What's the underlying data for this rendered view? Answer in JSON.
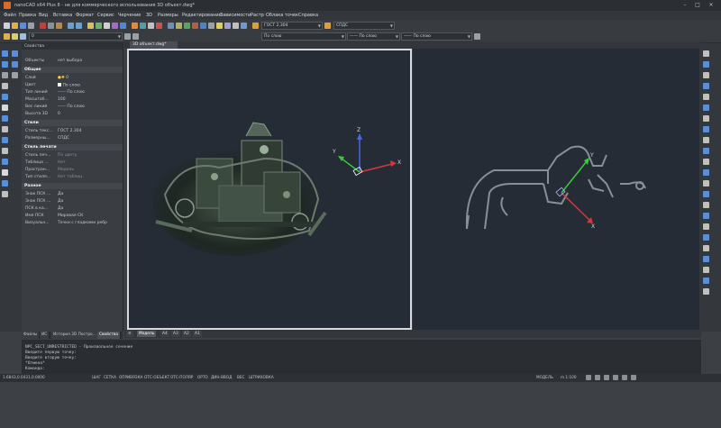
{
  "window": {
    "title": "nanoCAD x64 Plus 8 - не для коммерческого использования 3D объект.dwg*",
    "controls": [
      "–",
      "□",
      "×"
    ]
  },
  "menu": [
    "Файл",
    "Правка",
    "Вид",
    "Вставка",
    "Формат",
    "Сервис",
    "Черчение",
    "3D",
    "Размеры",
    "Редактирование",
    "Зависимости",
    "Растр",
    "Облака точек",
    "Справка"
  ],
  "toolbar": {
    "textstyle": "ГОСТ 2.304",
    "dimstyle": "СПДС",
    "layer": "0",
    "linetype": "По слою",
    "lineweight": "По слою",
    "color": "По слою"
  },
  "properties": {
    "header": "Свойства",
    "object_label": "Объекты",
    "object_value": "нет выбора",
    "categories": [
      {
        "name": "Общие",
        "rows": [
          {
            "k": "Слой",
            "v": "0"
          },
          {
            "k": "Цвет",
            "v": "По слою"
          },
          {
            "k": "Тип линий",
            "v": "—— По слою"
          },
          {
            "k": "Масштаб...",
            "v": "100"
          },
          {
            "k": "Вес линий",
            "v": "—— По слою"
          },
          {
            "k": "Высота 3D",
            "v": "0"
          }
        ]
      },
      {
        "name": "Стили",
        "rows": [
          {
            "k": "Стиль текс...",
            "v": "ГОСТ 2.304"
          },
          {
            "k": "Размерны...",
            "v": "СПДС"
          }
        ]
      },
      {
        "name": "Стиль печати",
        "rows": [
          {
            "k": "Стиль печ...",
            "v": "По цвету"
          },
          {
            "k": "Таблица ...",
            "v": "Нет"
          },
          {
            "k": "Простран...",
            "v": "Модель"
          },
          {
            "k": "Тип стиля...",
            "v": "Нет таблиц"
          }
        ]
      },
      {
        "name": "Разное",
        "rows": [
          {
            "k": "Знак ПСК ...",
            "v": "Да"
          },
          {
            "k": "Знак ПСК ...",
            "v": "Да"
          },
          {
            "k": "ПСК в ка...",
            "v": "Да"
          },
          {
            "k": "Имя ПСК",
            "v": "Мировая СК"
          },
          {
            "k": "Визуальн...",
            "v": "Точки с гладкими ребр"
          }
        ]
      }
    ],
    "tabs": [
      "Файлы",
      "ИС",
      "История 3D Постро...",
      "Свойства"
    ]
  },
  "document": {
    "tab": "3D объект.dwg*"
  },
  "viewport": {
    "axis_x": "X",
    "axis_y": "Y",
    "axis_z": "Z"
  },
  "model_tabs": [
    "Модель",
    "A4",
    "A3",
    "A2",
    "A1"
  ],
  "command": {
    "lines": [
      "NPC_SECT_UNRESTRICTED - Произвольное сечение",
      "Введите первую точку:",
      "Введите вторую точку:",
      "*Отмена*",
      "Команда:"
    ]
  },
  "status": {
    "coords": "1.6843,0.0431,0.0000",
    "modes": [
      "ШАГ",
      "СЕТКА",
      "ОПРИВЯЗКА",
      "ОТС-ОБЪЕКТ",
      "ОТС-ПОЛЯР",
      "ОРТО",
      "ДИН-ВВОД",
      "ВЕС",
      "ШТРИХОВКА"
    ],
    "model": "МОДЕЛЬ",
    "scale": "m 1:100"
  },
  "colors": {
    "viewport_bg": "#252c35",
    "accent_x": "#d23a3a",
    "accent_y": "#3acb3a",
    "accent_z": "#4a6adf"
  }
}
